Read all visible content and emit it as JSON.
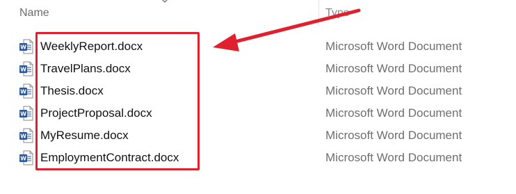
{
  "header": {
    "name_label": "Name",
    "type_label": "Type"
  },
  "files": [
    {
      "name": "WeeklyReport.docx",
      "type": "Microsoft Word Document",
      "icon": "word-doc-icon"
    },
    {
      "name": "TravelPlans.docx",
      "type": "Microsoft Word Document",
      "icon": "word-doc-icon"
    },
    {
      "name": "Thesis.docx",
      "type": "Microsoft Word Document",
      "icon": "word-doc-icon"
    },
    {
      "name": "ProjectProposal.docx",
      "type": "Microsoft Word Document",
      "icon": "word-doc-icon"
    },
    {
      "name": "MyResume.docx",
      "type": "Microsoft Word Document",
      "icon": "word-doc-icon"
    },
    {
      "name": "EmploymentContract.docx",
      "type": "Microsoft Word Document",
      "icon": "word-doc-icon"
    }
  ],
  "colors": {
    "annotation": "#e0202e",
    "word_blue": "#2b579a"
  }
}
